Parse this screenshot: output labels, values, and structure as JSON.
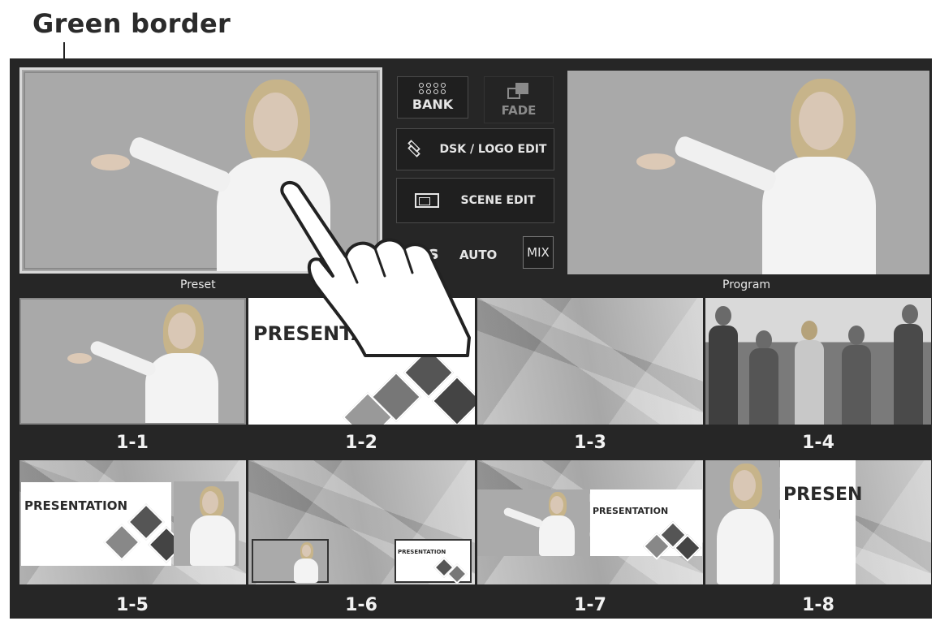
{
  "callout": {
    "label": "Green border"
  },
  "monitors": {
    "preset_label": "Preset",
    "program_label": "Program"
  },
  "controls": {
    "bank_label": "BANK",
    "fade_label": "FADE",
    "dsk_label": "DSK / LOGO EDIT",
    "scene_label": "SCENE EDIT",
    "time_value": "0s",
    "auto_label": "AUTO",
    "mix_label": "MIX"
  },
  "thumbnails": [
    {
      "label": "1-1"
    },
    {
      "label": "1-2",
      "text": "PRESENTATION"
    },
    {
      "label": "1-3"
    },
    {
      "label": "1-4"
    },
    {
      "label": "1-5",
      "text": "PRESENTATION"
    },
    {
      "label": "1-6",
      "text": "PRESENTATION"
    },
    {
      "label": "1-7",
      "text": "PRESENTATION"
    },
    {
      "label": "1-8",
      "text": "PRESEN"
    }
  ],
  "icons": [
    "bank-icon",
    "fade-icon",
    "layers-icon",
    "scene-icon",
    "hand-pointer-icon"
  ]
}
